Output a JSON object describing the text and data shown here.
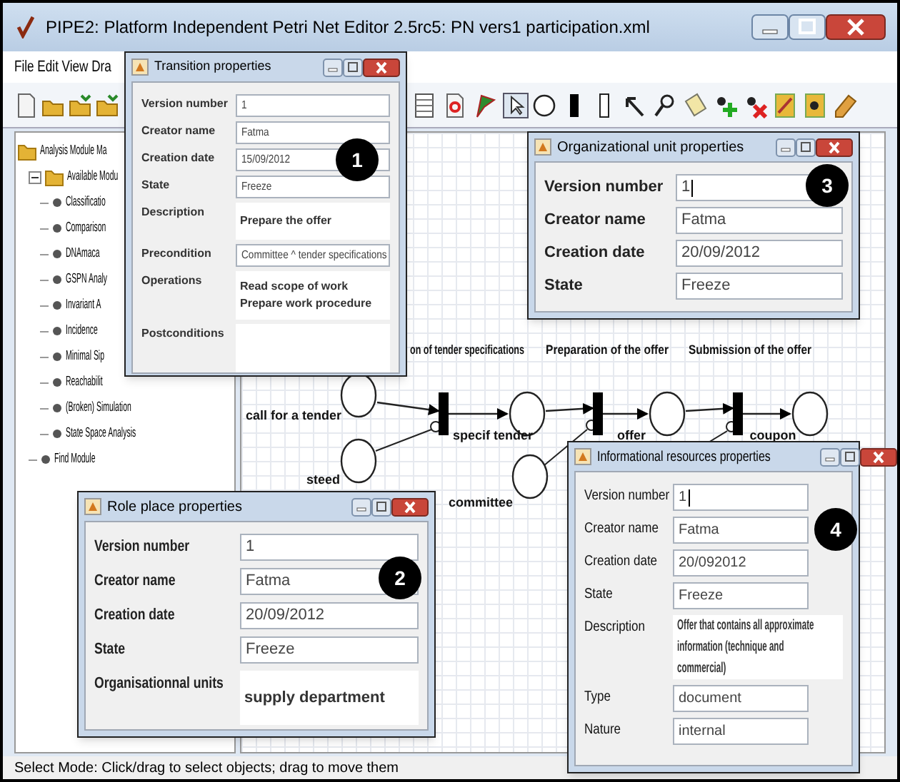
{
  "window": {
    "title": "PIPE2: Platform Independent Petri Net Editor 2.5rc5: PN vers1 participation.xml"
  },
  "menu": [
    "File",
    "Edit",
    "View",
    "Dra"
  ],
  "tree": {
    "label": "Analysis Module Ma",
    "children": [
      {
        "label": "Available Modu",
        "expanded": true,
        "children": [
          {
            "label": "Classificatio"
          },
          {
            "label": "Comparison"
          },
          {
            "label": "DNAmaca"
          },
          {
            "label": "GSPN Analy"
          },
          {
            "label": "Invariant A"
          },
          {
            "label": "Incidence"
          },
          {
            "label": "Minimal Sip"
          },
          {
            "label": "Reachabilit"
          },
          {
            "label": "(Broken) Simulation"
          },
          {
            "label": "State Space Analysis"
          }
        ]
      },
      {
        "label": "Find Module"
      }
    ]
  },
  "net": {
    "headings": [
      "on of tender specifications",
      "Preparation of the offer",
      "Submission of the offer"
    ],
    "places": [
      {
        "label": "call for a tender"
      },
      {
        "label": "steed"
      },
      {
        "label": "committee"
      }
    ],
    "transitions": [
      {
        "label": "specif tender"
      },
      {
        "label": "offer"
      },
      {
        "label": "coupon"
      }
    ]
  },
  "dialogs": [
    {
      "title": "Transition properties",
      "badge": "1",
      "fields": [
        {
          "kind": "field",
          "label": "Version number",
          "value": "1"
        },
        {
          "kind": "field",
          "label": "Creator name",
          "value": "Fatma"
        },
        {
          "kind": "field",
          "label": "Creation date",
          "value": "15/09/2012"
        },
        {
          "kind": "field",
          "label": "State",
          "value": "Freeze"
        },
        {
          "kind": "area",
          "label": "Description",
          "lines": [
            "Prepare the offer"
          ]
        },
        {
          "kind": "field",
          "label": "Precondition",
          "value": "Committee ^ tender specifications"
        },
        {
          "kind": "area",
          "label": "Operations",
          "lines": [
            "Read scope of work",
            "Prepare work procedure"
          ]
        },
        {
          "kind": "area",
          "label": "Postconditions"
        }
      ]
    },
    {
      "title": "Role place properties",
      "badge": "2",
      "fields": [
        {
          "kind": "field",
          "label": "Version number",
          "value": "1"
        },
        {
          "kind": "field",
          "label": "Creator name",
          "value": "Fatma"
        },
        {
          "kind": "field",
          "label": "Creation date",
          "value": "20/09/2012"
        },
        {
          "kind": "field",
          "label": "State",
          "value": "Freeze"
        },
        {
          "kind": "area",
          "label": "Organisationnal units",
          "lines": [
            "supply department"
          ]
        }
      ]
    },
    {
      "title": "Organizational unit properties",
      "badge": "3",
      "fields": [
        {
          "kind": "field",
          "label": "Version number",
          "value": "1",
          "focused": true
        },
        {
          "kind": "field",
          "label": "Creator name",
          "value": "Fatma"
        },
        {
          "kind": "field",
          "label": "Creation date",
          "value": "20/09/2012"
        },
        {
          "kind": "field",
          "label": "State",
          "value": "Freeze"
        }
      ]
    },
    {
      "title": "Informational resources properties",
      "badge": "4",
      "fields": [
        {
          "kind": "field",
          "label": "Version number",
          "value": "1",
          "focused": true
        },
        {
          "kind": "field",
          "label": "Creator name",
          "value": "Fatma"
        },
        {
          "kind": "field",
          "label": "Creation date",
          "value": "20/092012"
        },
        {
          "kind": "field",
          "label": "State",
          "value": "Freeze"
        },
        {
          "kind": "area",
          "label": "Description",
          "lines": [
            "Offer that contains all approximate",
            "information (technique and",
            "commercial)"
          ]
        },
        {
          "kind": "field",
          "label": "Type",
          "value": "document"
        },
        {
          "kind": "field",
          "label": "Nature",
          "value": "internal"
        }
      ]
    }
  ],
  "status_bar": "Select Mode: Click/drag to select objects; drag to move them"
}
